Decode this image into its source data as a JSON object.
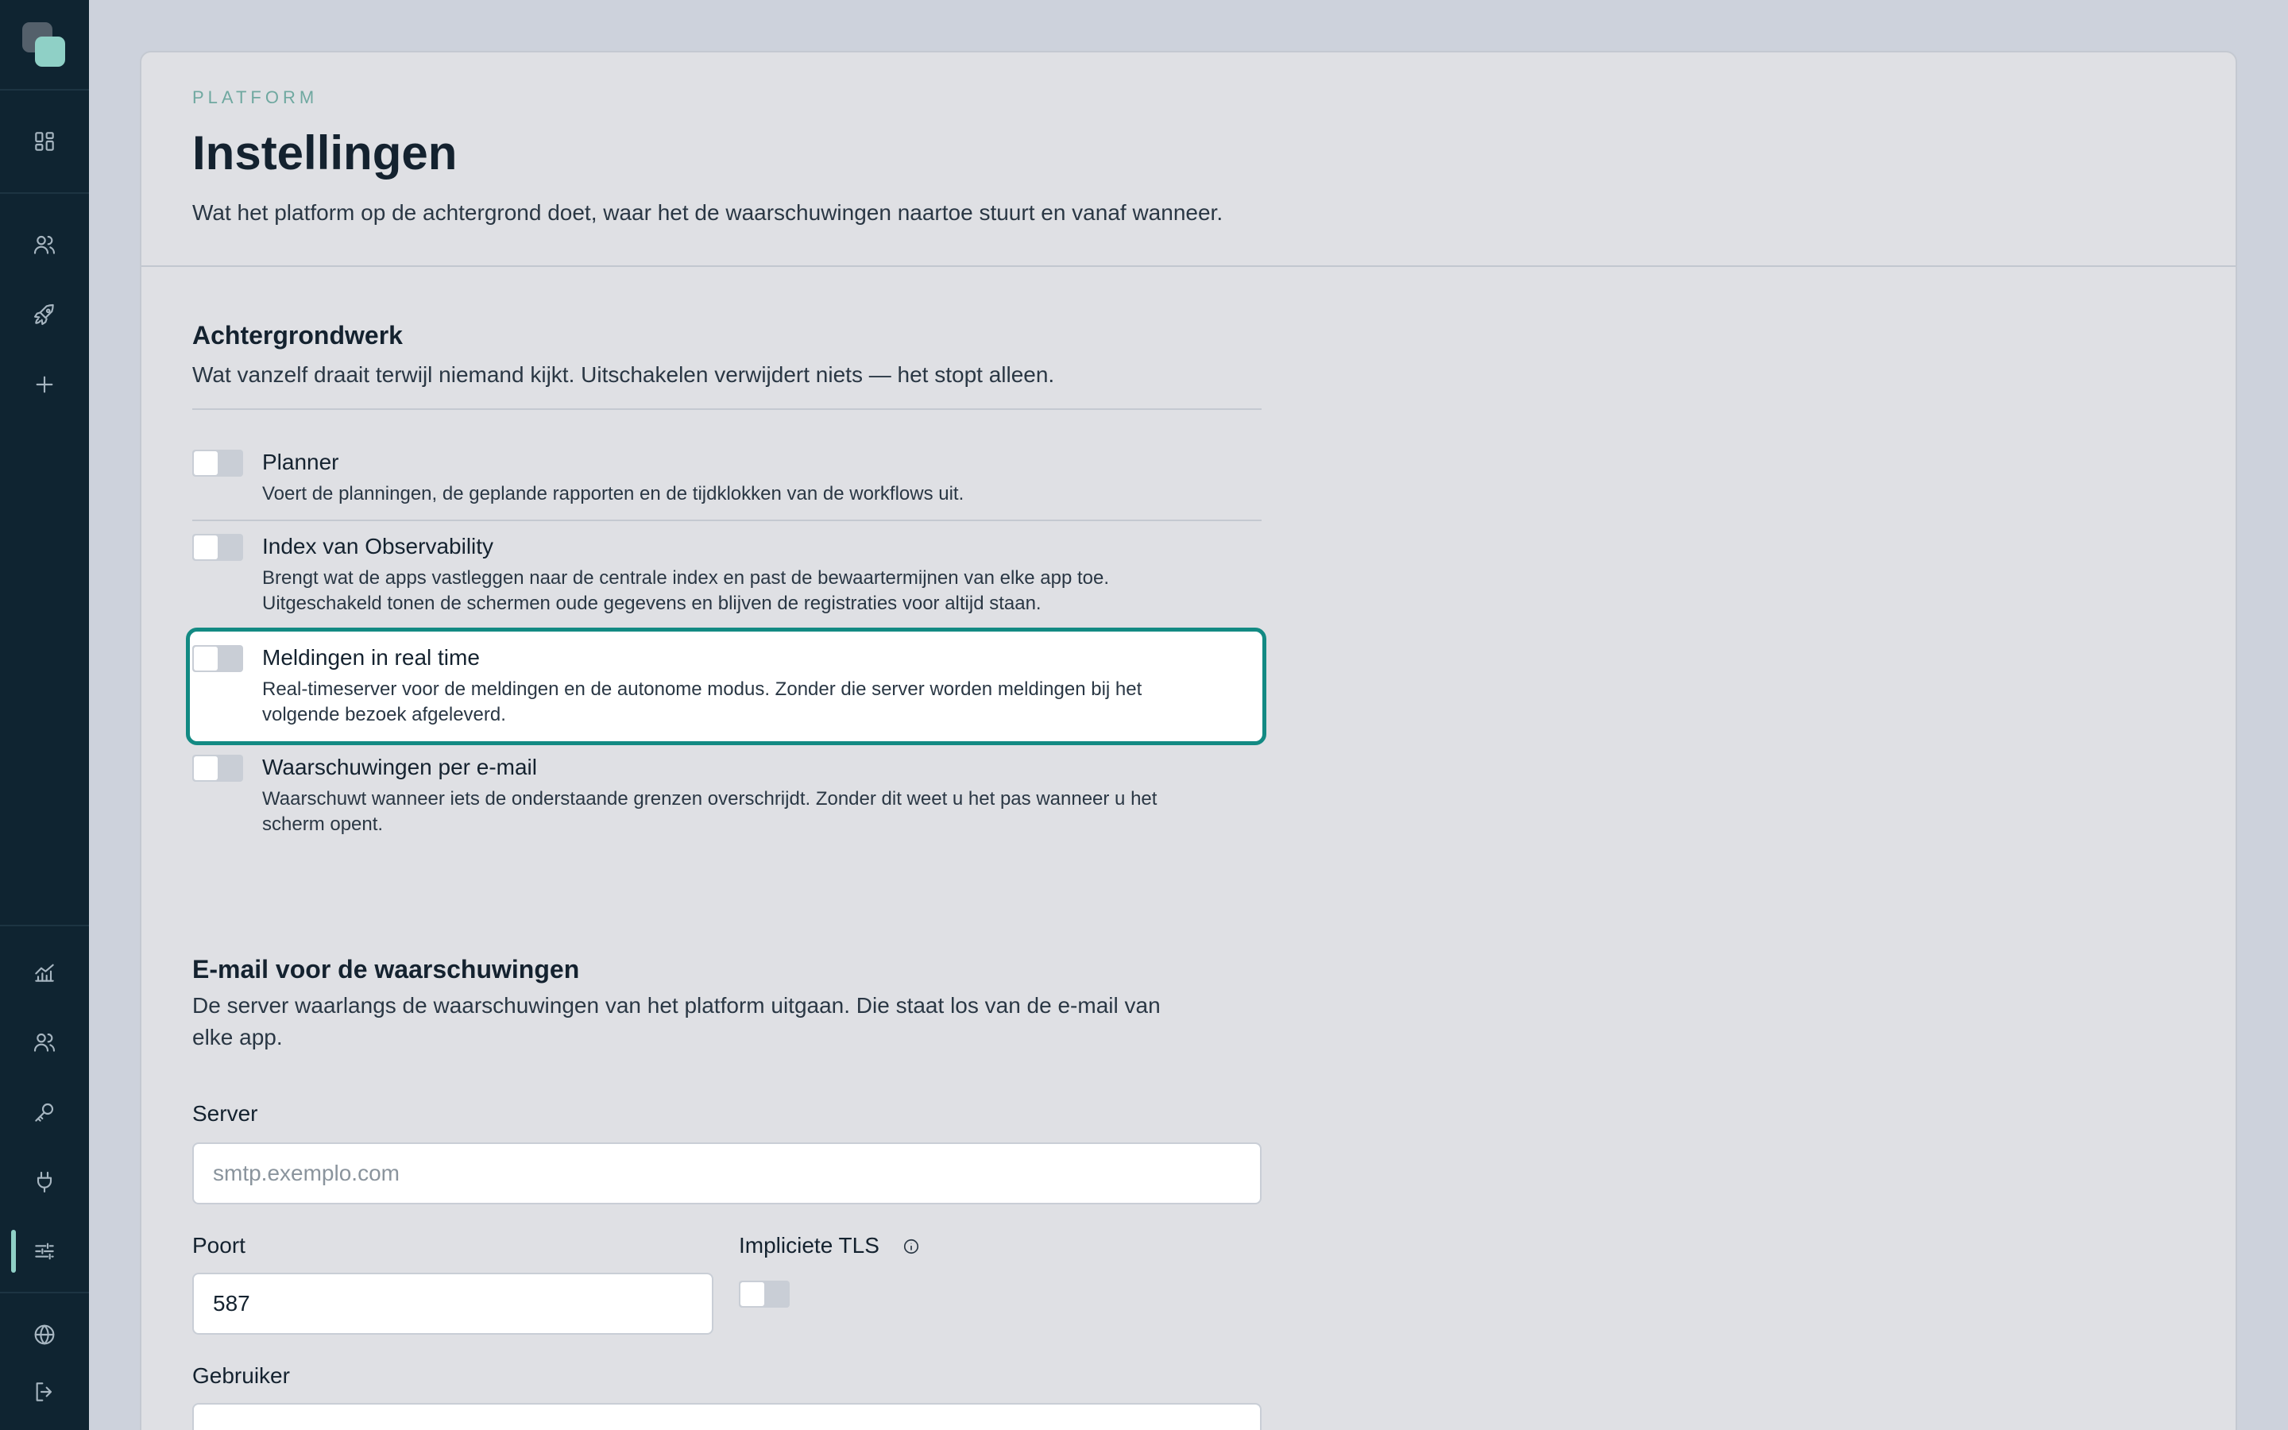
{
  "header": {
    "eyebrow": "PLATFORM",
    "title": "Instellingen",
    "description": "Wat het platform op de achtergrond doet, waar het de waarschuwingen naartoe stuurt en vanaf wanneer."
  },
  "background_section": {
    "title": "Achtergrondwerk",
    "description": "Wat vanzelf draait terwijl niemand kijkt. Uitschakelen verwijdert niets — het stopt alleen.",
    "items": [
      {
        "title": "Planner",
        "lines": [
          "Voert de planningen, de geplande rapporten en de tijdklokken van de workflows uit."
        ]
      },
      {
        "title": "Index van Observability",
        "lines": [
          "Brengt wat de apps vastleggen naar de centrale index en past de bewaartermijnen van elke app toe.",
          "Uitgeschakeld tonen de schermen oude gegevens en blijven de registraties voor altijd staan."
        ]
      },
      {
        "title": "Meldingen in real time",
        "lines": [
          "Real-timeserver voor de meldingen en de autonome modus. Zonder die server worden meldingen bij het",
          "volgende bezoek afgeleverd."
        ]
      },
      {
        "title": "Waarschuwingen per e-mail",
        "lines": [
          "Waarschuwt wanneer iets de onderstaande grenzen overschrijdt. Zonder dit weet u het pas wanneer u het",
          "scherm opent."
        ]
      }
    ]
  },
  "email_section": {
    "title": "E-mail voor de waarschuwingen",
    "description_lines": [
      "De server waarlangs de waarschuwingen van het platform uitgaan. Die staat los van de e-mail van",
      "elke app."
    ],
    "server_label": "Server",
    "server_placeholder": "smtp.exemplo.com",
    "server_value": "",
    "port_label": "Poort",
    "port_value": "587",
    "tls_label": "Impliciete TLS",
    "user_label": "Gebruiker",
    "user_value": ""
  },
  "colors": {
    "sidebar": "#0f2431",
    "accent": "#8fd0c6",
    "focus": "#138a83"
  },
  "sidebar": {
    "icons": [
      "dashboard-icon",
      "users-icon",
      "rocket-icon",
      "plus-icon",
      "analytics-icon",
      "team-icon",
      "key-icon",
      "plug-icon",
      "settings-sliders-icon",
      "globe-icon",
      "logout-icon"
    ]
  }
}
